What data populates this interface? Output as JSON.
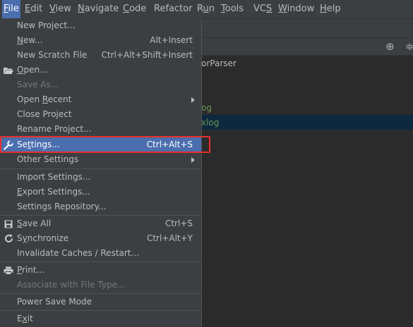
{
  "menubar": {
    "items": [
      {
        "pre": "",
        "mn": "F",
        "post": "ile"
      },
      {
        "pre": "",
        "mn": "E",
        "post": "dit"
      },
      {
        "pre": "",
        "mn": "V",
        "post": "iew"
      },
      {
        "pre": "",
        "mn": "N",
        "post": "avigate"
      },
      {
        "pre": "",
        "mn": "C",
        "post": "ode"
      },
      {
        "pre": "",
        "mn": "",
        "post": "Refactor"
      },
      {
        "pre": "R",
        "mn": "u",
        "post": "n"
      },
      {
        "pre": "",
        "mn": "T",
        "post": "ools"
      },
      {
        "pre": "VC",
        "mn": "S",
        "post": ""
      },
      {
        "pre": "",
        "mn": "W",
        "post": "indow"
      },
      {
        "pre": "",
        "mn": "H",
        "post": "elp"
      }
    ]
  },
  "background": {
    "tree_item_1": "orParser",
    "tree_item_2": "og",
    "tree_item_3": "xlog",
    "tool_icon_1": "⊕",
    "tool_icon_2": "≑"
  },
  "file_menu": {
    "new_project": "New Project...",
    "new": {
      "pre": "",
      "mn": "N",
      "post": "ew...",
      "shortcut": "Alt+Insert"
    },
    "new_scratch": {
      "label": "New Scratch File",
      "shortcut": "Ctrl+Alt+Shift+Insert"
    },
    "open": {
      "pre": "",
      "mn": "O",
      "post": "pen..."
    },
    "save_as": "Save As...",
    "open_recent": {
      "pre": "Open ",
      "mn": "R",
      "post": "ecent"
    },
    "close_project": "Close Project",
    "rename_project": "Rename Project...",
    "settings": {
      "pre": "Se",
      "mn": "t",
      "post": "tings...",
      "shortcut": "Ctrl+Alt+S"
    },
    "other_settings": "Other Settings",
    "import_settings": {
      "pre": "Import Settings...",
      "mn": "",
      "post": ""
    },
    "export_settings": {
      "pre": "",
      "mn": "E",
      "post": "xport Settings..."
    },
    "settings_repository": "Settings Repository...",
    "save_all": {
      "pre": "",
      "mn": "S",
      "post": "ave All",
      "shortcut": "Ctrl+S"
    },
    "synchronize": {
      "pre": "S",
      "mn": "y",
      "post": "nchronize",
      "shortcut": "Ctrl+Alt+Y"
    },
    "invalidate_caches": "Invalidate Caches / Restart...",
    "print": {
      "pre": "",
      "mn": "P",
      "post": "rint..."
    },
    "associate": "Associate with File Type...",
    "power_save": "Power Save Mode",
    "exit": {
      "pre": "E",
      "mn": "x",
      "post": "it"
    }
  },
  "colors": {
    "menu_bg": "#3c3f41",
    "highlight": "#4b6eaf",
    "annotation_box": "#e8302b",
    "tree_green": "#6a9955"
  }
}
